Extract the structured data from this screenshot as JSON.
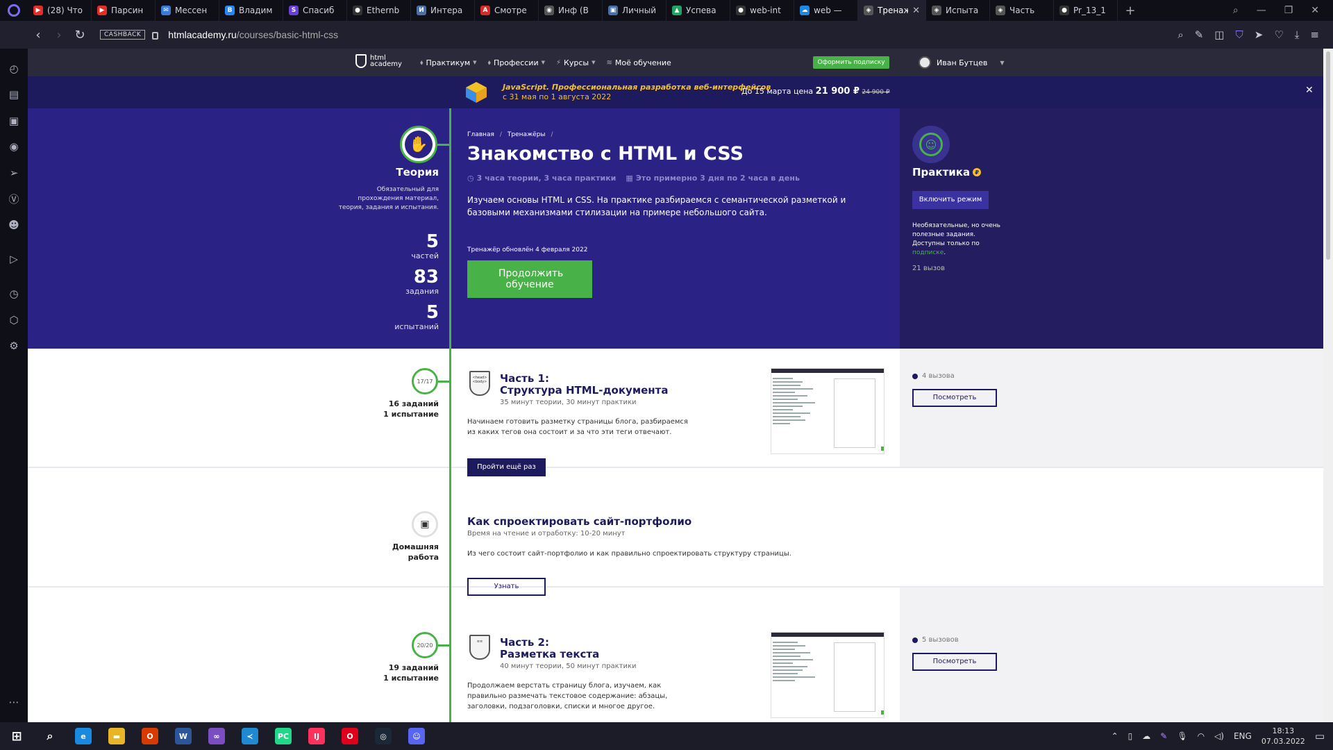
{
  "browser": {
    "tabs": [
      {
        "title": "(28) Что",
        "color": "#e52d27",
        "glyph": "▶"
      },
      {
        "title": "Парсин",
        "color": "#e52d27",
        "glyph": "▶"
      },
      {
        "title": "Мессен",
        "color": "#3a7bd5",
        "glyph": "✉"
      },
      {
        "title": "Владим",
        "color": "#2787f5",
        "glyph": "В"
      },
      {
        "title": "Спасиб",
        "color": "#6a3fd8",
        "glyph": "S"
      },
      {
        "title": "Ethernb",
        "color": "#333333",
        "glyph": "●"
      },
      {
        "title": "Интера",
        "color": "#4a6fa5",
        "glyph": "И"
      },
      {
        "title": "Смотре",
        "color": "#d62b2b",
        "glyph": "А"
      },
      {
        "title": "Инф (В",
        "color": "#555555",
        "glyph": "◉"
      },
      {
        "title": "Личный",
        "color": "#4a6fa5",
        "glyph": "▣"
      },
      {
        "title": "Успева",
        "color": "#1fa463",
        "glyph": "▲"
      },
      {
        "title": "web-int",
        "color": "#333333",
        "glyph": "●"
      },
      {
        "title": "web —",
        "color": "#1e88e5",
        "glyph": "☁"
      },
      {
        "title": "Тренаж",
        "color": "#555555",
        "glyph": "◈",
        "active": true
      },
      {
        "title": "Испыта",
        "color": "#555555",
        "glyph": "◈"
      },
      {
        "title": "Часть",
        "color": "#555555",
        "glyph": "◈"
      },
      {
        "title": "Pr_13_1",
        "color": "#333333",
        "glyph": "●"
      }
    ],
    "cashback_label": "CASHBACK",
    "url_domain": "htmlacademy.ru",
    "url_path": "/courses/basic-html-css"
  },
  "site": {
    "logo_line1": "html",
    "logo_line2": "academy",
    "menu": [
      {
        "icon": "⬧",
        "label": "Практикум"
      },
      {
        "icon": "⬧",
        "label": "Профессии"
      },
      {
        "icon": "⚡",
        "label": "Курсы"
      },
      {
        "icon": "≋",
        "label": "Моё обучение"
      }
    ],
    "subscribe": "Оформить подписку",
    "user_name": "Иван Бутцев"
  },
  "promo": {
    "title": "JavaScript. Профессиональная разработка веб-интерфейсов",
    "dates": "с 31 мая по 1 августа 2022",
    "price_prefix": "До 15 марта цена",
    "price": "21 900 ₽",
    "old_price": "24 900 ₽"
  },
  "theory": {
    "title": "Теория",
    "desc": "Обязательный для прохождения материал, теория, задания и испытания.",
    "stats": [
      {
        "num": "5",
        "label": "частей"
      },
      {
        "num": "83",
        "label": "задания"
      },
      {
        "num": "5",
        "label": "испытаний"
      }
    ]
  },
  "course": {
    "breadcrumb_home": "Главная",
    "breadcrumb_trainers": "Тренажёры",
    "title": "Знакомство с HTML и CSS",
    "duration": "3 часа теории, 3 часа практики",
    "estimate": "Это примерно 3 дня по 2 часа в день",
    "desc": "Изучаем основы HTML и CSS. На практике разбираемся с семантической разметкой и базовыми механизмами стилизации на примере небольшого сайта.",
    "updated": "Тренажёр обновлён 4 февраля 2022",
    "continue": "Продолжить обучение"
  },
  "practice": {
    "title": "Практика",
    "enable": "Включить режим",
    "desc_before": "Необязательные, но очень полезные задания. Доступны только по",
    "desc_link": "подписке",
    "desc_after": ".",
    "count": "21 вызов"
  },
  "rows": [
    {
      "progress": "17/17",
      "meta_line1": "16 заданий",
      "meta_line2": "1 испытание",
      "icon_text": "<head><body>",
      "title_line1": "Часть 1:",
      "title_line2": "Структура HTML-документа",
      "sub": "35 минут теории, 30 минут практики",
      "desc": "Начинаем готовить разметку страницы блога, разбираемся из каких тегов она состоит и за что эти теги отвечают.",
      "button": "Пройти ещё раз",
      "challenges": "4 вызова",
      "view": "Посмотреть"
    },
    {
      "meta_line1": "Домашняя",
      "meta_line2": "работа",
      "title": "Как спроектировать сайт-портфолио",
      "sub": "Время на чтение и отработку: 10-20 минут",
      "desc": "Из чего состоит сайт-портфолио и как правильно спроектировать структуру страницы.",
      "button": "Узнать"
    },
    {
      "progress": "20/20",
      "meta_line1": "19 заданий",
      "meta_line2": "1 испытание",
      "icon_text": "≡≡",
      "title_line1": "Часть 2:",
      "title_line2": "Разметка текста",
      "sub": "40 минут теории, 50 минут практики",
      "desc": "Продолжаем верстать страницу блога, изучаем, как правильно размечать текстовое содержание: абзацы, заголовки, подзаголовки, списки и многое другое.",
      "challenges": "5 вызовов",
      "view": "Посмотреть"
    }
  ],
  "taskbar": {
    "apps": [
      {
        "name": "edge",
        "color": "#1a8ae0",
        "glyph": "e"
      },
      {
        "name": "explorer",
        "color": "#e8b528",
        "glyph": "▬"
      },
      {
        "name": "office",
        "color": "#d83b01",
        "glyph": "O"
      },
      {
        "name": "word",
        "color": "#2b579a",
        "glyph": "W"
      },
      {
        "name": "visual-studio",
        "color": "#7a4dc0",
        "glyph": "∞"
      },
      {
        "name": "vscode",
        "color": "#1f8ad2",
        "glyph": "≺"
      },
      {
        "name": "pycharm",
        "color": "#21d789",
        "glyph": "PC"
      },
      {
        "name": "intellij",
        "color": "#fe315d",
        "glyph": "IJ"
      },
      {
        "name": "opera",
        "color": "#e0001b",
        "glyph": "O"
      },
      {
        "name": "steam",
        "color": "#1b2838",
        "glyph": "◎"
      },
      {
        "name": "discord",
        "color": "#5865f2",
        "glyph": "☺"
      }
    ],
    "lang": "ENG",
    "time": "18:13",
    "date": "07.03.2022"
  }
}
